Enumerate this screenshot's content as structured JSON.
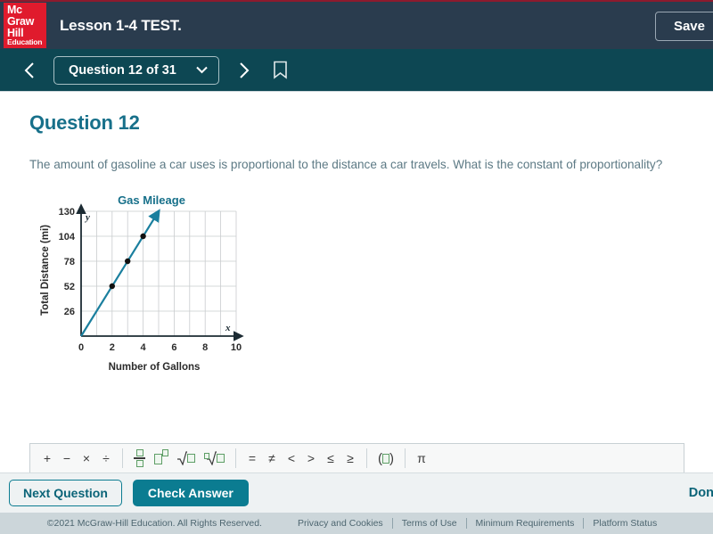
{
  "header": {
    "logo": {
      "line1": "Mc",
      "line2": "Graw",
      "line3": "Hill",
      "line4": "Education",
      "color": "#e01b2d"
    },
    "lesson_title": "Lesson 1-4 TEST.",
    "save_label": "Save",
    "bar_color": "#2a3c4e"
  },
  "nav": {
    "prev_icon": "chevron-left-icon",
    "next_icon": "chevron-right-icon",
    "question_selector": "Question 12 of 31",
    "chevron_icon": "chevron-down-icon",
    "bookmark_icon": "bookmark-icon",
    "bar_color": "#0d4753"
  },
  "main": {
    "question_title": "Question 12",
    "question_text": "The amount of gasoline a car uses is proportional to the distance a car travels. What is the constant of proportionality?",
    "accent_color": "#17708a"
  },
  "chart_data": {
    "type": "line",
    "title": "Gas Mileage",
    "xlabel": "Number of Gallons",
    "ylabel": "Total Distance (mi)",
    "x": [
      0,
      1,
      2,
      3,
      4,
      5
    ],
    "values": [
      0,
      26,
      52,
      78,
      104,
      130
    ],
    "points": [
      [
        2,
        52
      ],
      [
        3,
        78
      ],
      [
        4,
        104
      ]
    ],
    "xlim": [
      0,
      10
    ],
    "ylim": [
      0,
      130
    ],
    "xticks": [
      0,
      2,
      4,
      6,
      8,
      10
    ],
    "yticks": [
      0,
      26,
      52,
      78,
      104,
      130
    ],
    "x_gridline_step": 1,
    "y_gridline_step": 26,
    "grid": true,
    "legend": "none",
    "line_color": "#1a7f9e",
    "point_color": "#111111",
    "axis_x_marker": "x",
    "axis_y_marker": "y",
    "slope": 26
  },
  "math_toolbar": {
    "groups": [
      [
        {
          "name": "plus",
          "label": "+"
        },
        {
          "name": "minus",
          "label": "−"
        },
        {
          "name": "multiply",
          "label": "×"
        },
        {
          "name": "divide",
          "label": "÷"
        }
      ],
      [
        {
          "name": "fraction",
          "label": "fraction"
        },
        {
          "name": "exponent",
          "label": "exponent"
        },
        {
          "name": "square-root",
          "label": "square-root"
        },
        {
          "name": "nth-root",
          "label": "nth-root"
        }
      ],
      [
        {
          "name": "equals",
          "label": "="
        },
        {
          "name": "not-equals",
          "label": "≠"
        },
        {
          "name": "less-than",
          "label": "<"
        },
        {
          "name": "greater-than",
          "label": ">"
        },
        {
          "name": "less-or-equal",
          "label": "≤"
        },
        {
          "name": "greater-or-equal",
          "label": "≥"
        }
      ],
      [
        {
          "name": "parentheses",
          "label": "parentheses"
        }
      ],
      [
        {
          "name": "pi",
          "label": "π"
        }
      ]
    ]
  },
  "answer": {
    "value": "",
    "placeholder_box": true
  },
  "actions": {
    "next_question": "Next Question",
    "check_answer": "Check Answer",
    "done_and_continue": "Done an",
    "solid_color": "#0b7c91"
  },
  "footer": {
    "copyright": "©2021 McGraw-Hill Education. All Rights Reserved.",
    "links": [
      "Privacy and Cookies",
      "Terms of Use",
      "Minimum Requirements",
      "Platform Status"
    ]
  }
}
